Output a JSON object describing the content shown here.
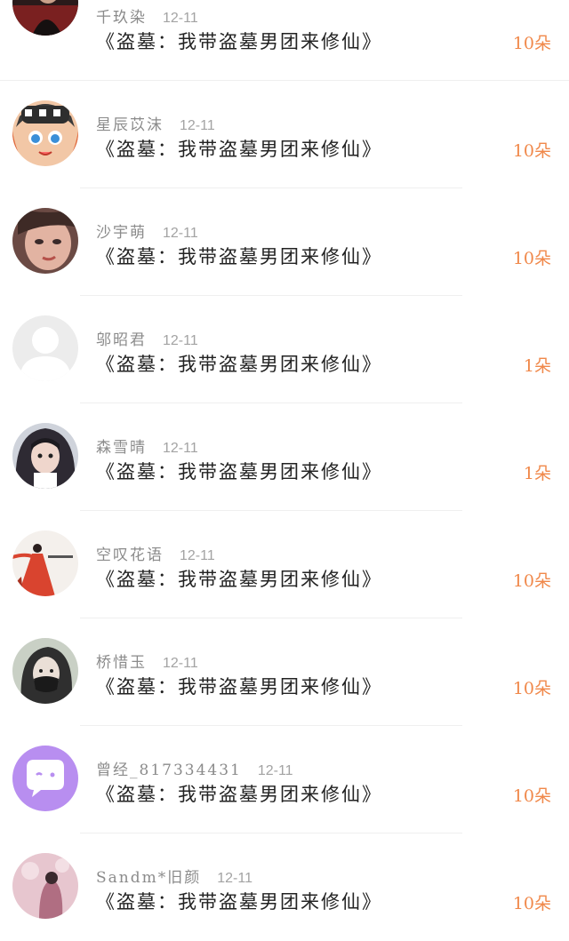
{
  "rows": [
    {
      "name": "千玖染",
      "date": "12-11",
      "title": "《盗墓：我带盗墓男团来修仙》",
      "amount": "10朵",
      "avatar_icon": "photo-avatar-dark",
      "avatar_color": "#5a2b2b"
    },
    {
      "name": "星辰苡沫",
      "date": "12-11",
      "title": "《盗墓：我带盗墓男团来修仙》",
      "amount": "10朵",
      "avatar_icon": "cartoon-girl-avatar",
      "avatar_color": "#e0683c"
    },
    {
      "name": "沙宇萌",
      "date": "12-11",
      "title": "《盗墓：我带盗墓男团来修仙》",
      "amount": "10朵",
      "avatar_icon": "photo-avatar-face",
      "avatar_color": "#c98f7a"
    },
    {
      "name": "邬昭君",
      "date": "12-11",
      "title": "《盗墓：我带盗墓男团来修仙》",
      "amount": "1朵",
      "avatar_icon": "default-user-avatar",
      "avatar_color": "#e6e6e6"
    },
    {
      "name": "森雪晴",
      "date": "12-11",
      "title": "《盗墓：我带盗墓男团来修仙》",
      "amount": "1朵",
      "avatar_icon": "photo-avatar-hood",
      "avatar_color": "#3b3340"
    },
    {
      "name": "空叹花语",
      "date": "12-11",
      "title": "《盗墓：我带盗墓男团来修仙》",
      "amount": "10朵",
      "avatar_icon": "ink-red-figure-avatar",
      "avatar_color": "#d9442f"
    },
    {
      "name": "桥惜玉",
      "date": "12-11",
      "title": "《盗墓：我带盗墓男团来修仙》",
      "amount": "10朵",
      "avatar_icon": "photo-avatar-mask",
      "avatar_color": "#6f7a6c"
    },
    {
      "name": "曾经_817334431",
      "date": "12-11",
      "title": "《盗墓：我带盗墓男团来修仙》",
      "amount": "10朵",
      "avatar_icon": "chat-bubble-avatar",
      "avatar_color": "#b88ef0"
    },
    {
      "name": "Sandm*旧颜",
      "date": "12-11",
      "title": "《盗墓：我带盗墓男团来修仙》",
      "amount": "10朵",
      "avatar_icon": "photo-avatar-pink",
      "avatar_color": "#d8a8b8"
    }
  ],
  "colors": {
    "accent": "#f0884a",
    "name": "#8b8b8b",
    "title": "#222222"
  }
}
